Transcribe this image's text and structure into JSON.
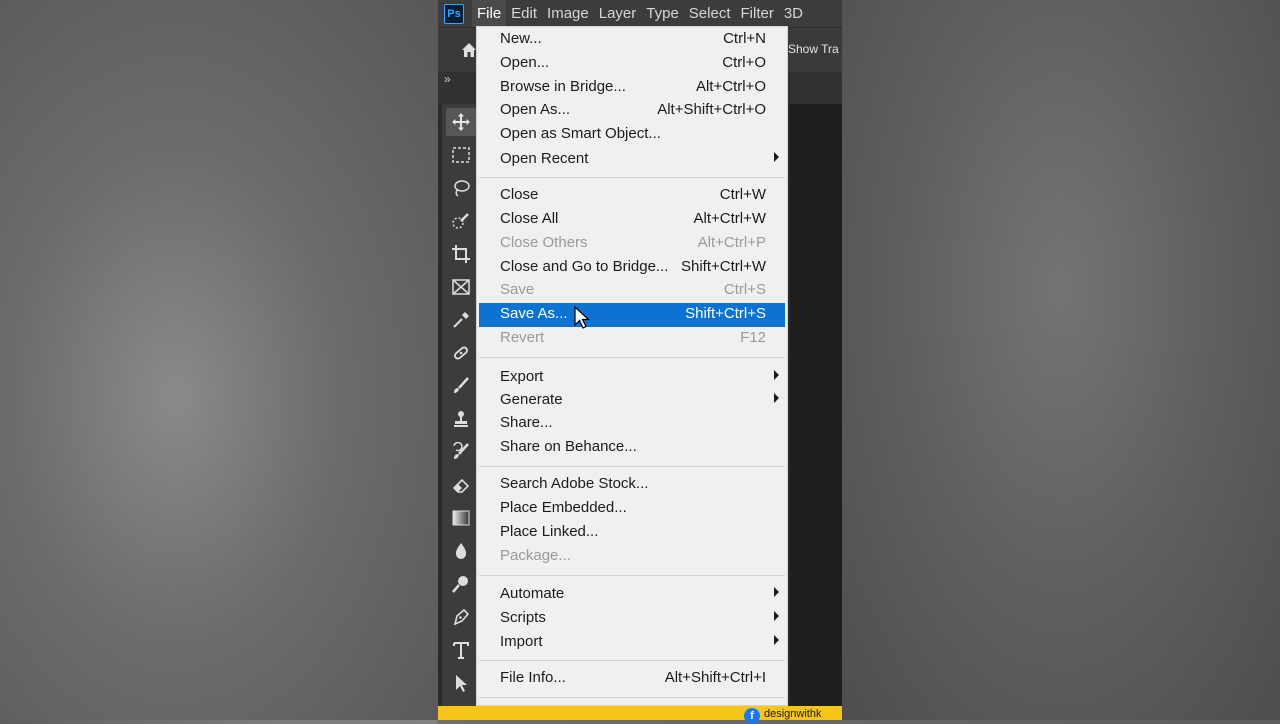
{
  "menubar": {
    "logo": "Ps",
    "items": [
      "File",
      "Edit",
      "Image",
      "Layer",
      "Type",
      "Select",
      "Filter",
      "3D"
    ]
  },
  "options": {
    "show_transform": "Show Tra"
  },
  "panel": {
    "toggle": "»"
  },
  "file_menu": {
    "new": {
      "label": "New...",
      "shortcut": "Ctrl+N"
    },
    "open": {
      "label": "Open...",
      "shortcut": "Ctrl+O"
    },
    "browse_bridge": {
      "label": "Browse in Bridge...",
      "shortcut": "Alt+Ctrl+O"
    },
    "open_as": {
      "label": "Open As...",
      "shortcut": "Alt+Shift+Ctrl+O"
    },
    "open_smart": {
      "label": "Open as Smart Object..."
    },
    "open_recent": {
      "label": "Open Recent"
    },
    "close": {
      "label": "Close",
      "shortcut": "Ctrl+W"
    },
    "close_all": {
      "label": "Close All",
      "shortcut": "Alt+Ctrl+W"
    },
    "close_others": {
      "label": "Close Others",
      "shortcut": "Alt+Ctrl+P"
    },
    "close_bridge": {
      "label": "Close and Go to Bridge...",
      "shortcut": "Shift+Ctrl+W"
    },
    "save": {
      "label": "Save",
      "shortcut": "Ctrl+S"
    },
    "save_as": {
      "label": "Save As...",
      "shortcut": "Shift+Ctrl+S"
    },
    "revert": {
      "label": "Revert",
      "shortcut": "F12"
    },
    "export": {
      "label": "Export"
    },
    "generate": {
      "label": "Generate"
    },
    "share": {
      "label": "Share..."
    },
    "share_behance": {
      "label": "Share on Behance..."
    },
    "search_stock": {
      "label": "Search Adobe Stock..."
    },
    "place_embedded": {
      "label": "Place Embedded..."
    },
    "place_linked": {
      "label": "Place Linked..."
    },
    "package": {
      "label": "Package..."
    },
    "automate": {
      "label": "Automate"
    },
    "scripts": {
      "label": "Scripts"
    },
    "import": {
      "label": "Import"
    },
    "file_info": {
      "label": "File Info...",
      "shortcut": "Alt+Shift+Ctrl+I"
    }
  },
  "footer": {
    "fb": "f",
    "brand": "designwithk"
  },
  "colors": {
    "highlight": "#0d73d3",
    "menu_bg": "#f0f0f0",
    "banner": "#f5c518"
  }
}
